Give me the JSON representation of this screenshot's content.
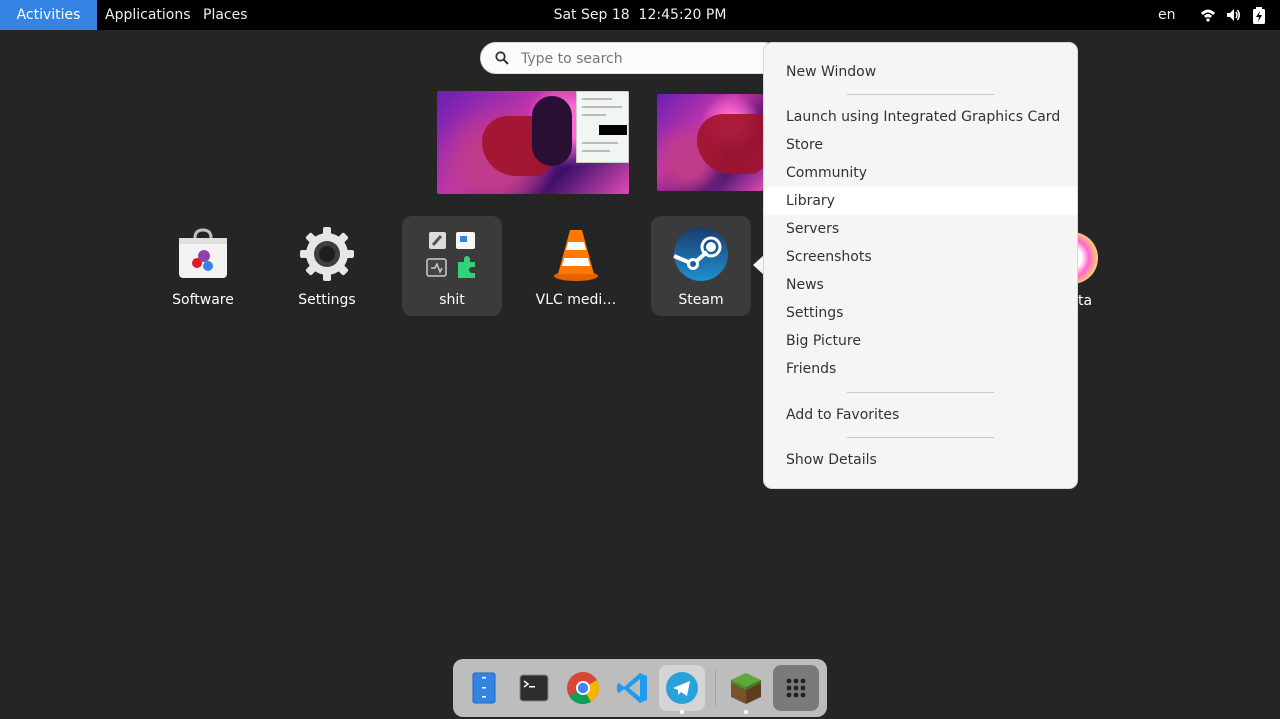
{
  "topbar": {
    "activities": "Activities",
    "applications": "Applications",
    "places": "Places",
    "clock": "Sat Sep 18  12:45:20 PM",
    "lang": "en",
    "tray_icons": [
      "wifi-icon",
      "volume-icon",
      "battery-icon"
    ]
  },
  "search": {
    "placeholder": "Type to search"
  },
  "apps": [
    {
      "label": "Software",
      "icon": "software-store-icon"
    },
    {
      "label": "Settings",
      "icon": "settings-gear-icon"
    },
    {
      "label": "shit",
      "icon": "folder-grid-icon"
    },
    {
      "label": "VLC medi…",
      "icon": "vlc-cone-icon"
    },
    {
      "label": "Steam",
      "icon": "steam-icon"
    }
  ],
  "partial_app_label": "ta",
  "context_menu": {
    "items": [
      "New Window",
      "Launch using Integrated Graphics Card",
      "Store",
      "Community",
      "Library",
      "Servers",
      "Screenshots",
      "News",
      "Settings",
      "Big Picture",
      "Friends",
      "Add to Favorites",
      "Show Details"
    ],
    "hovered": "Library"
  },
  "dock": {
    "items": [
      "files-icon",
      "terminal-icon",
      "chrome-icon",
      "vscode-icon",
      "telegram-icon",
      "minecraft-icon",
      "show-apps-grid-icon"
    ],
    "running": [
      "telegram-icon",
      "minecraft-icon"
    ]
  },
  "colors": {
    "accent": "#3584e4",
    "background": "#252525",
    "menu_bg": "#f6f5f4"
  }
}
